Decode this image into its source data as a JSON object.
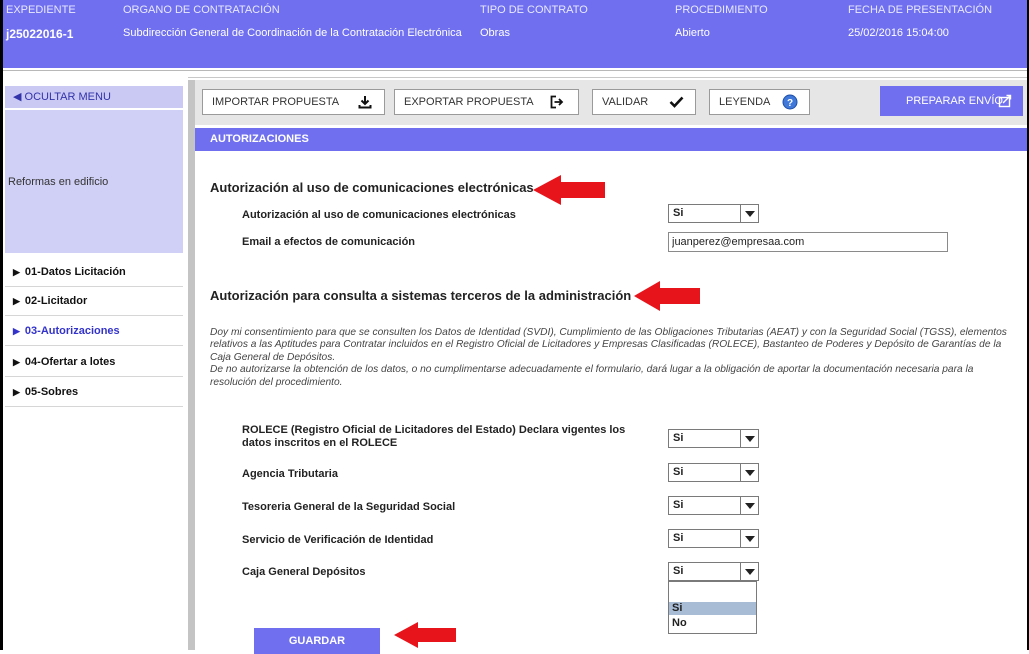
{
  "header": {
    "columns": [
      {
        "label": "EXPEDIENTE",
        "value": "j25022016-1"
      },
      {
        "label": "ORGANO DE CONTRATACIÓN",
        "value": "Subdirección General de Coordinación de la Contratación Electrónica"
      },
      {
        "label": "TIPO DE CONTRATO",
        "value": "Obras"
      },
      {
        "label": "PROCEDIMIENTO",
        "value": "Abierto"
      },
      {
        "label": "FECHA DE PRESENTACIÓN",
        "value": "25/02/2016 15:04:00"
      }
    ]
  },
  "sidebar": {
    "toggle_label": "◀ OCULTAR MENU",
    "project_name": "Reformas en edificio",
    "items": [
      {
        "label": "01-Datos Licitación"
      },
      {
        "label": "02-Licitador"
      },
      {
        "label": "03-Autorizaciones"
      },
      {
        "label": "04-Ofertar a lotes"
      },
      {
        "label": "05-Sobres"
      }
    ]
  },
  "toolbar": {
    "import_label": "IMPORTAR PROPUESTA",
    "export_label": "EXPORTAR PROPUESTA",
    "validate_label": "VALIDAR",
    "legend_label": "LEYENDA",
    "prepare_label": "PREPARAR ENVÍO"
  },
  "section": {
    "title": "AUTORIZACIONES"
  },
  "electronic": {
    "heading": "Autorización al uso de comunicaciones electrónicas",
    "auth_label": "Autorización al uso de comunicaciones electrónicas",
    "auth_value": "Si",
    "email_label": "Email a efectos de comunicación",
    "email_value": "juanperez@empresaa.com"
  },
  "third_party": {
    "heading": "Autorización para consulta a sistemas terceros de la administración",
    "consent_p1": "Doy mi consentimiento para que se consulten los Datos de Identidad (SVDI), Cumplimiento de las Obligaciones Tributarias (AEAT) y con la Seguridad Social (TGSS), elementos relativos a las Aptitudes para Contratar incluidos en el Registro Oficial de Licitadores y Empresas Clasificadas (ROLECE), Bastanteo de Poderes y Depósito de Garantías de la Caja General de Depósitos.",
    "consent_p2": "De no autorizarse la obtención de los datos, o no cumplimentarse adecuadamente el formulario, dará lugar a la obligación de aportar la documentación necesaria para la resolución del procedimiento.",
    "rows": [
      {
        "label": "ROLECE (Registro Oficial de Licitadores del Estado) Declara vigentes los datos inscritos en el ROLECE",
        "value": "Si"
      },
      {
        "label": "Agencia Tributaria",
        "value": "Si"
      },
      {
        "label": "Tesoreria General de la Seguridad Social",
        "value": "Si"
      },
      {
        "label": "Servicio de Verificación de Identidad",
        "value": "Si"
      },
      {
        "label": "Caja General Depósitos",
        "value": "Si"
      }
    ],
    "dropdown_options": [
      "",
      "Si",
      "No"
    ]
  },
  "save_label": "GUARDAR",
  "colors": {
    "accent": "#6f6ff0",
    "sidebar_bg": "#d0d0f6",
    "highlight_arrow": "#e8141b"
  }
}
